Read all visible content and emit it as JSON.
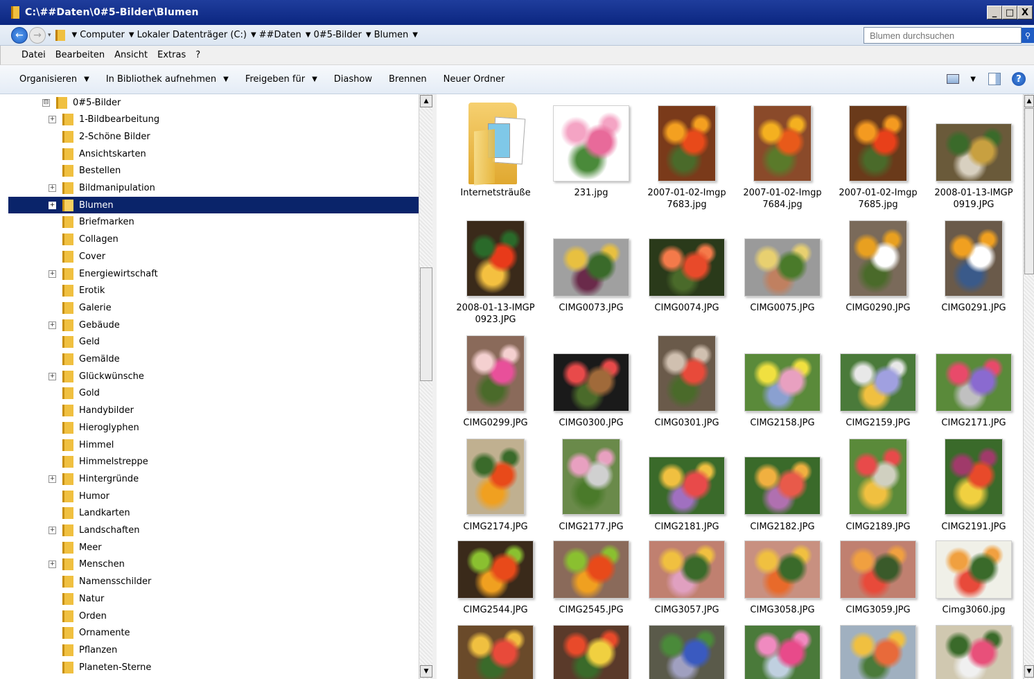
{
  "window": {
    "title": "C:\\##Daten\\0#5-Bilder\\Blumen",
    "buttons": [
      "_",
      "□",
      "X"
    ]
  },
  "address": {
    "crumbs": [
      "Computer",
      "Lokaler Datenträger (C:)",
      "##Daten",
      "0#5-Bilder",
      "Blumen"
    ],
    "search_placeholder": "Blumen durchsuchen"
  },
  "menu": [
    "Datei",
    "Bearbeiten",
    "Ansicht",
    "Extras",
    "?"
  ],
  "commands": [
    {
      "label": "Organisieren",
      "dropdown": true
    },
    {
      "label": "In Bibliothek aufnehmen",
      "dropdown": true
    },
    {
      "label": "Freigeben für",
      "dropdown": true
    },
    {
      "label": "Diashow",
      "dropdown": false
    },
    {
      "label": "Brennen",
      "dropdown": false
    },
    {
      "label": "Neuer Ordner",
      "dropdown": false
    }
  ],
  "tree": {
    "root": {
      "label": "0#5-Bilder",
      "expander": "⊟"
    },
    "items": [
      {
        "label": "1-Bildbearbeitung",
        "expander": "+"
      },
      {
        "label": "2-Schöne Bilder",
        "expander": ""
      },
      {
        "label": "Ansichtskarten",
        "expander": ""
      },
      {
        "label": "Bestellen",
        "expander": ""
      },
      {
        "label": "Bildmanipulation",
        "expander": "+"
      },
      {
        "label": "Blumen",
        "expander": "+",
        "selected": true
      },
      {
        "label": "Briefmarken",
        "expander": ""
      },
      {
        "label": "Collagen",
        "expander": ""
      },
      {
        "label": "Cover",
        "expander": ""
      },
      {
        "label": "Energiewirtschaft",
        "expander": "+"
      },
      {
        "label": "Erotik",
        "expander": ""
      },
      {
        "label": "Galerie",
        "expander": ""
      },
      {
        "label": "Gebäude",
        "expander": "+"
      },
      {
        "label": "Geld",
        "expander": ""
      },
      {
        "label": "Gemälde",
        "expander": ""
      },
      {
        "label": "Glückwünsche",
        "expander": "+"
      },
      {
        "label": "Gold",
        "expander": ""
      },
      {
        "label": "Handybilder",
        "expander": ""
      },
      {
        "label": "Hieroglyphen",
        "expander": ""
      },
      {
        "label": "Himmel",
        "expander": ""
      },
      {
        "label": "Himmelstreppe",
        "expander": ""
      },
      {
        "label": "Hintergründe",
        "expander": "+"
      },
      {
        "label": "Humor",
        "expander": ""
      },
      {
        "label": "Landkarten",
        "expander": ""
      },
      {
        "label": "Landschaften",
        "expander": "+"
      },
      {
        "label": "Meer",
        "expander": ""
      },
      {
        "label": "Menschen",
        "expander": "+"
      },
      {
        "label": "Namensschilder",
        "expander": ""
      },
      {
        "label": "Natur",
        "expander": ""
      },
      {
        "label": "Orden",
        "expander": ""
      },
      {
        "label": "Ornamente",
        "expander": ""
      },
      {
        "label": "Pflanzen",
        "expander": ""
      },
      {
        "label": "Planeten-Sterne",
        "expander": ""
      }
    ]
  },
  "files": [
    {
      "name": "Internetsträuße",
      "kind": "folder",
      "orient": "folder"
    },
    {
      "name": "231.jpg",
      "kind": "image",
      "orient": "square",
      "colors": [
        "#ffffff",
        "#e86a9a",
        "#f4a4c4",
        "#4a8a3a"
      ]
    },
    {
      "name": "2007-01-02-Imgp 7683.jpg",
      "kind": "image",
      "orient": "portrait",
      "colors": [
        "#7a3a1a",
        "#e84a1a",
        "#f4a020",
        "#4a6a2a"
      ]
    },
    {
      "name": "2007-01-02-Imgp 7684.jpg",
      "kind": "image",
      "orient": "portrait",
      "colors": [
        "#8a4a2a",
        "#e85a1a",
        "#f4b020",
        "#5a7a2a"
      ]
    },
    {
      "name": "2007-01-02-Imgp 7685.jpg",
      "kind": "image",
      "orient": "portrait",
      "colors": [
        "#6a3a1a",
        "#e8401a",
        "#f49a20",
        "#4a6a2a"
      ]
    },
    {
      "name": "2008-01-13-IMGP 0919.JPG",
      "kind": "image",
      "orient": "landscape",
      "colors": [
        "#6a5a3a",
        "#c8a040",
        "#3a6a2a",
        "#d8d0c0"
      ]
    },
    {
      "name": "2008-01-13-IMGP 0923.JPG",
      "kind": "image",
      "orient": "portrait",
      "colors": [
        "#3a2a1a",
        "#e83a1a",
        "#2a6a2a",
        "#f4c040"
      ]
    },
    {
      "name": "CIMG0073.JPG",
      "kind": "image",
      "orient": "landscape",
      "colors": [
        "#a0a0a0",
        "#3a6a2a",
        "#e8c040",
        "#6a2a4a"
      ]
    },
    {
      "name": "CIMG0074.JPG",
      "kind": "image",
      "orient": "landscape",
      "colors": [
        "#2a3a1a",
        "#e84a2a",
        "#f47a4a",
        "#4a6a2a"
      ]
    },
    {
      "name": "CIMG0075.JPG",
      "kind": "image",
      "orient": "landscape",
      "colors": [
        "#9a9a9a",
        "#4a7a2a",
        "#e8d070",
        "#c08060"
      ]
    },
    {
      "name": "CIMG0290.JPG",
      "kind": "image",
      "orient": "portrait",
      "colors": [
        "#7a6a5a",
        "#ffffff",
        "#e8a020",
        "#4a6a2a"
      ]
    },
    {
      "name": "CIMG0291.JPG",
      "kind": "image",
      "orient": "portrait",
      "colors": [
        "#6a5a4a",
        "#ffffff",
        "#f0a020",
        "#3a5a8a"
      ]
    },
    {
      "name": "CIMG0299.JPG",
      "kind": "image",
      "orient": "portrait",
      "colors": [
        "#8a6a5a",
        "#e8509a",
        "#f4d0d0",
        "#4a6a2a"
      ]
    },
    {
      "name": "CIMG0300.JPG",
      "kind": "image",
      "orient": "landscape",
      "colors": [
        "#1a1a1a",
        "#a06a3a",
        "#e84a4a",
        "#4a6a2a"
      ]
    },
    {
      "name": "CIMG0301.JPG",
      "kind": "image",
      "orient": "portrait",
      "colors": [
        "#6a5a4a",
        "#e84a3a",
        "#d0c0b0",
        "#4a6a2a"
      ]
    },
    {
      "name": "CIMG2158.JPG",
      "kind": "image",
      "orient": "landscape",
      "colors": [
        "#5a8a3a",
        "#e8a0c0",
        "#f0e040",
        "#8aa0d0"
      ]
    },
    {
      "name": "CIMG2159.JPG",
      "kind": "image",
      "orient": "landscape",
      "colors": [
        "#4a7a3a",
        "#a0a0e0",
        "#e8e8e8",
        "#f0c040"
      ]
    },
    {
      "name": "CIMG2171.JPG",
      "kind": "image",
      "orient": "landscape",
      "colors": [
        "#5a8a3a",
        "#8a6ad0",
        "#e84a6a",
        "#c0c0c0"
      ]
    },
    {
      "name": "CIMG2174.JPG",
      "kind": "image",
      "orient": "portrait",
      "colors": [
        "#c0b090",
        "#e84a1a",
        "#3a6a2a",
        "#f0a020"
      ]
    },
    {
      "name": "CIMG2177.JPG",
      "kind": "image",
      "orient": "portrait",
      "colors": [
        "#6a8a4a",
        "#d0d0d0",
        "#e8a0c0",
        "#4a7a2a"
      ]
    },
    {
      "name": "CIMG2181.JPG",
      "kind": "image",
      "orient": "landscape",
      "colors": [
        "#3a6a2a",
        "#e84a4a",
        "#f0c040",
        "#a070c0"
      ]
    },
    {
      "name": "CIMG2182.JPG",
      "kind": "image",
      "orient": "landscape",
      "colors": [
        "#3a6a2a",
        "#e85a4a",
        "#f0b040",
        "#b070b0"
      ]
    },
    {
      "name": "CIMG2189.JPG",
      "kind": "image",
      "orient": "portrait",
      "colors": [
        "#5a8a3a",
        "#d0d0c0",
        "#e84a4a",
        "#f0c040"
      ]
    },
    {
      "name": "CIMG2191.JPG",
      "kind": "image",
      "orient": "portrait",
      "colors": [
        "#3a6a2a",
        "#e84a2a",
        "#a03a6a",
        "#f0d040"
      ]
    },
    {
      "name": "CIMG2544.JPG",
      "kind": "image",
      "orient": "landscape",
      "colors": [
        "#3a2a1a",
        "#e84a1a",
        "#8ac030",
        "#f0a020"
      ]
    },
    {
      "name": "CIMG2545.JPG",
      "kind": "image",
      "orient": "landscape",
      "colors": [
        "#8a6a5a",
        "#e84a1a",
        "#8ac030",
        "#f0a020"
      ]
    },
    {
      "name": "CIMG3057.JPG",
      "kind": "image",
      "orient": "landscape",
      "colors": [
        "#c08070",
        "#3a6a2a",
        "#f0c040",
        "#e0a0c0"
      ]
    },
    {
      "name": "CIMG3058.JPG",
      "kind": "image",
      "orient": "landscape",
      "colors": [
        "#c89080",
        "#3a6a2a",
        "#f0c040",
        "#e86a2a"
      ]
    },
    {
      "name": "CIMG3059.JPG",
      "kind": "image",
      "orient": "landscape",
      "colors": [
        "#c08070",
        "#3a5a2a",
        "#f0a040",
        "#e84a3a"
      ]
    },
    {
      "name": "Cimg3060.jpg",
      "kind": "image",
      "orient": "landscape",
      "colors": [
        "#f0f0e8",
        "#3a6a2a",
        "#f0a040",
        "#e84a3a"
      ]
    },
    {
      "name": "",
      "kind": "image",
      "orient": "landscape-crop",
      "colors": [
        "#6a4a2a",
        "#e84a3a",
        "#f0c040",
        "#3a6a2a"
      ]
    },
    {
      "name": "",
      "kind": "image",
      "orient": "landscape-crop",
      "colors": [
        "#5a3a2a",
        "#f0d040",
        "#e84a2a",
        "#3a6a2a"
      ]
    },
    {
      "name": "",
      "kind": "image",
      "orient": "landscape-crop",
      "colors": [
        "#5a5a4a",
        "#3a5ac0",
        "#4a8a3a",
        "#a0a0c0"
      ]
    },
    {
      "name": "",
      "kind": "image",
      "orient": "landscape-crop",
      "colors": [
        "#4a7a3a",
        "#e84a8a",
        "#f08ac0",
        "#c0d0e0"
      ]
    },
    {
      "name": "",
      "kind": "image",
      "orient": "landscape-crop",
      "colors": [
        "#a0b0c0",
        "#e86a3a",
        "#f0c040",
        "#4a7a3a"
      ]
    },
    {
      "name": "",
      "kind": "image",
      "orient": "landscape-crop",
      "colors": [
        "#d0c8b0",
        "#e8507a",
        "#3a6a2a",
        "#f0f0f0"
      ]
    }
  ]
}
